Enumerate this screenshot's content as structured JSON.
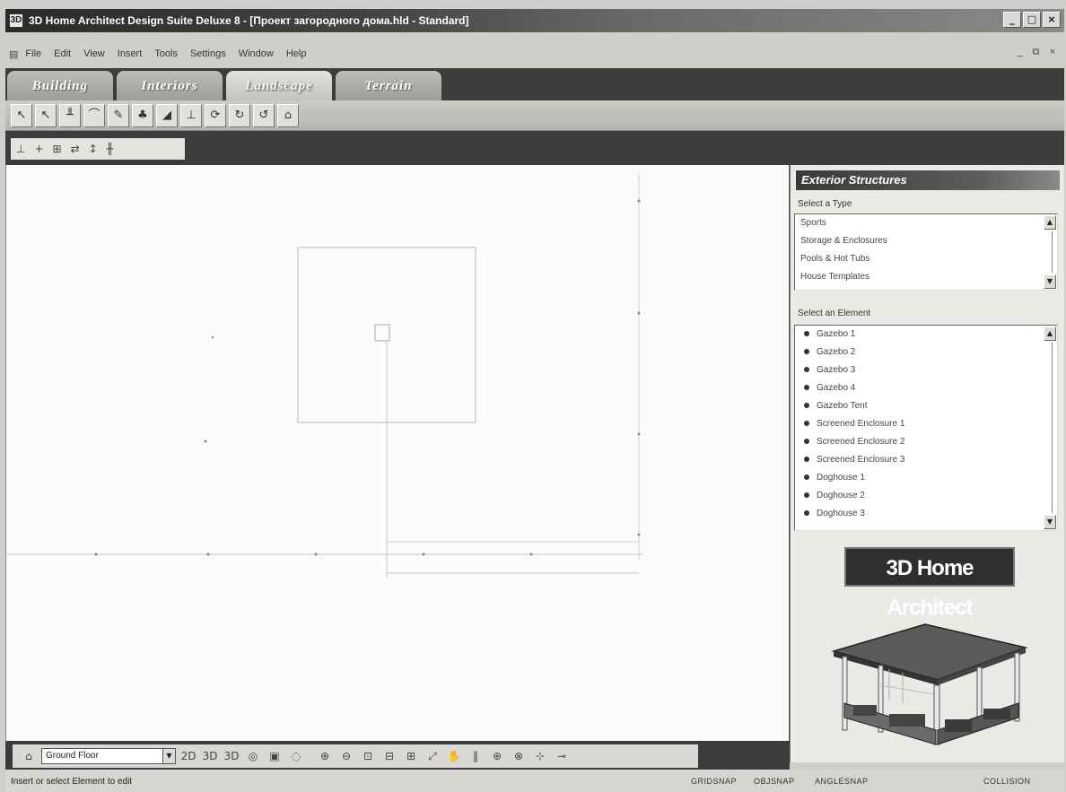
{
  "window": {
    "title": "3D Home Architect Design Suite Deluxe 8 - [Проект загородного дома.hld - Standard]",
    "buttons": [
      "_",
      "□",
      "×"
    ]
  },
  "menu": {
    "items": [
      "File",
      "Edit",
      "View",
      "Insert",
      "Tools",
      "Settings",
      "Window",
      "Help"
    ],
    "mdi_controls": "_ ⧉ ×"
  },
  "tabs": [
    {
      "label": "Building",
      "active": false
    },
    {
      "label": "Interiors",
      "active": false
    },
    {
      "label": "Landscape",
      "active": true
    },
    {
      "label": "Terrain",
      "active": false
    }
  ],
  "toolbar": {
    "icons": [
      "select-arrow-icon",
      "select-plus-icon",
      "fence-icon",
      "path-icon",
      "pencil-icon",
      "plant-icon",
      "paint-icon",
      "text-icon",
      "refresh-icon",
      "rotate-icon",
      "lasso-icon",
      "house-icon"
    ],
    "glyphs": [
      "↖",
      "↖",
      "╨",
      "⌒",
      "✎",
      "♣",
      "◢",
      "⊥",
      "⟳",
      "↻",
      "↺",
      "⌂"
    ]
  },
  "toolbar2": {
    "icons": [
      "align-icon",
      "add-point-icon",
      "grid-icon",
      "move-icon",
      "resize-icon",
      "parallel-icon"
    ],
    "glyphs": [
      "⊥",
      "+",
      "⊞",
      "⇄",
      "↕",
      "╫"
    ]
  },
  "panel": {
    "title": "Exterior Structures",
    "type_label": "Select a Type",
    "types": [
      "Sports",
      "Storage & Enclosures",
      "Pools & Hot Tubs",
      "House Templates"
    ],
    "element_label": "Select an Element",
    "elements": [
      "Gazebo 1",
      "Gazebo 2",
      "Gazebo 3",
      "Gazebo 4",
      "Gazebo Tent",
      "Screened Enclosure 1",
      "Screened Enclosure 2",
      "Screened Enclosure 3",
      "Doghouse 1",
      "Doghouse 2",
      "Doghouse 3"
    ],
    "logo_text": "3D Home Architect"
  },
  "bottombar": {
    "floor_value": "Ground Floor",
    "view_buttons": [
      "2D",
      "3D",
      "3D",
      "◎",
      "▣",
      "◌"
    ],
    "zoom_buttons": [
      "⊕",
      "⊖",
      "⊡",
      "⊟",
      "⊞",
      "⤢",
      "✋",
      "‖",
      "⊕",
      "⊗",
      "⊹",
      "⊸"
    ]
  },
  "status": {
    "message": "Insert or select Element to edit",
    "indicators": [
      "GRIDSNAP",
      "OBJSNAP",
      "ANGLESNAP",
      "COLLISION"
    ]
  },
  "colors": {
    "title_dark": "#2a2a2a",
    "tab_bar": "#3c3c3c",
    "canvas": "#fbfbfa",
    "panel": "#ebeae7"
  }
}
